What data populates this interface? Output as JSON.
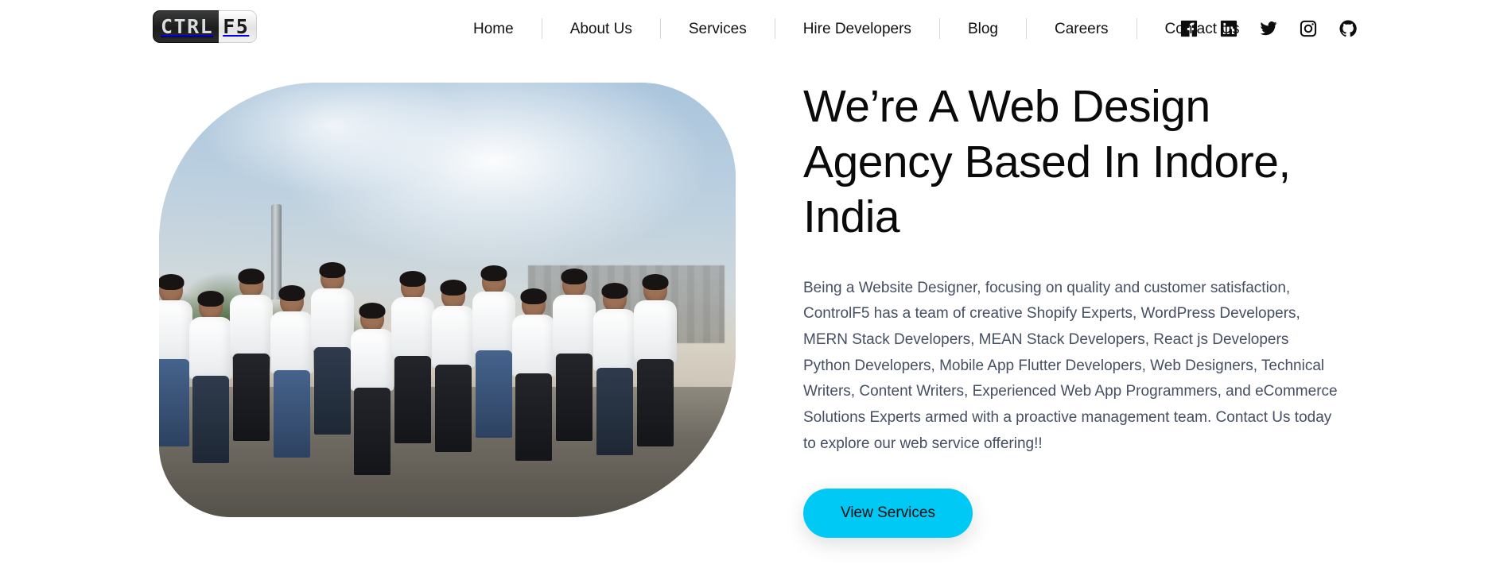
{
  "header": {
    "logo": {
      "part1": "CTRL",
      "part2": "F5",
      "name": "ControlF5"
    },
    "nav": [
      {
        "label": "Home"
      },
      {
        "label": "About Us"
      },
      {
        "label": "Services"
      },
      {
        "label": "Hire Developers"
      },
      {
        "label": "Blog"
      },
      {
        "label": "Careers"
      },
      {
        "label": "Contact Us"
      }
    ],
    "socials": [
      {
        "name": "facebook-icon",
        "label": "Facebook"
      },
      {
        "name": "linkedin-icon",
        "label": "LinkedIn"
      },
      {
        "name": "twitter-icon",
        "label": "Twitter"
      },
      {
        "name": "instagram-icon",
        "label": "Instagram"
      },
      {
        "name": "github-icon",
        "label": "GitHub"
      }
    ]
  },
  "hero": {
    "image_alt": "ControlF5 team group photo on rooftop",
    "headline": "We’re A Web Design Agency Based In Indore, India",
    "paragraph": "Being a Website Designer, focusing on quality and customer satisfaction, ControlF5 has a team of creative Shopify Experts, WordPress Developers, MERN Stack Developers, MEAN Stack Developers, React js Developers Python Developers, Mobile App Flutter Developers, Web Designers, Technical Writers, Content Writers, Experienced Web App Programmers, and eCommerce Solutions Experts armed with a proactive management team. Contact Us today to explore our web service offering!!",
    "cta_label": "View Services"
  },
  "colors": {
    "cta_background": "#00c9f5",
    "headline": "#0a0a0a",
    "body_text": "#454f63",
    "nav_text": "#111111",
    "page_background": "#ffffff"
  }
}
